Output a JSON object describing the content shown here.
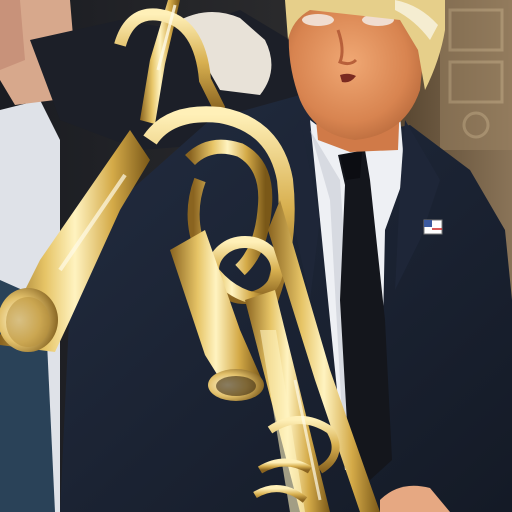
{
  "image": {
    "kind": "photograph",
    "palette": {
      "background_dark": "#161a22",
      "background_warm": "#5c4a34",
      "wall_ornament": "#a89070",
      "suit": "#1c2536",
      "shirt": "#eef0f4",
      "tie": "#14161c",
      "skin": "#e09060",
      "hair": "#e6cf8a",
      "brass_light": "#fff3c0",
      "brass_mid": "#e6c466",
      "brass_dark": "#8a6420",
      "pin": "#ffffff"
    }
  }
}
